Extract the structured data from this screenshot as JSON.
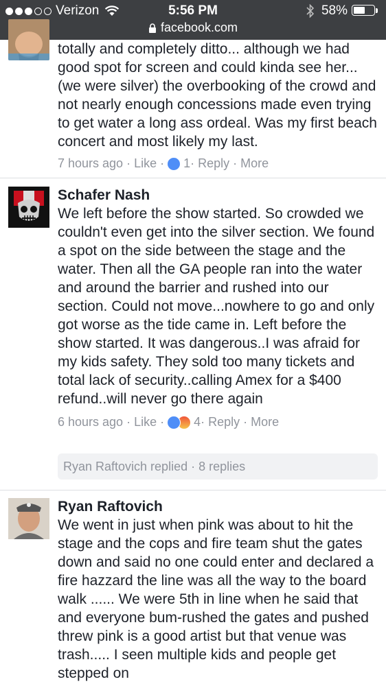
{
  "status_bar": {
    "carrier": "Verizon",
    "time": "5:56 PM",
    "battery": "58%",
    "battery_level": 0.58,
    "url": "facebook.com"
  },
  "comments": [
    {
      "author": "",
      "text": "totally and completely ditto... although we had good spot for screen and could kinda see her... (we were silver) the overbooking of the crowd and not nearly enough concessions made even trying to get water a long ass ordeal. Was my first beach concert and most likely my last.",
      "time": "7 hours ago",
      "like": "Like",
      "reaction_count": "1",
      "reply": "Reply",
      "more": "More"
    },
    {
      "author": "Schafer Nash",
      "text": "We left before the show started. So crowded we couldn't even get into the silver section. We found a spot on the side between the stage and the water. Then all the GA people ran into the water and around the barrier and rushed into our section. Could not move...nowhere to go and only got worse as the tide came in. Left before the show started. It was dangerous..I was afraid for my kids safety. They sold too many tickets and total lack of security..calling Amex for a $400 refund..will never go there again",
      "time": "6 hours ago",
      "like": "Like",
      "reaction_count": "4",
      "reply": "Reply",
      "more": "More",
      "replies_summary": "Ryan Raftovich replied · 8 replies"
    },
    {
      "author": "Ryan Raftovich",
      "text": "We went in just when pink was about to hit the stage and the cops and fire team shut the gates down and said no one could enter and declared a fire hazzard the line was all the way to the board walk ...... We were 5th in line when he said that and everyone bum-rushed the gates and pushed threw pink is a good artist but that venue was trash..... I seen multiple kids and people get stepped on"
    }
  ],
  "colors": {
    "status_bar_bg": "#3d3f42",
    "link_gray": "#90949c",
    "like_blue": "#4f8ef7",
    "divider": "#dddfe2"
  }
}
